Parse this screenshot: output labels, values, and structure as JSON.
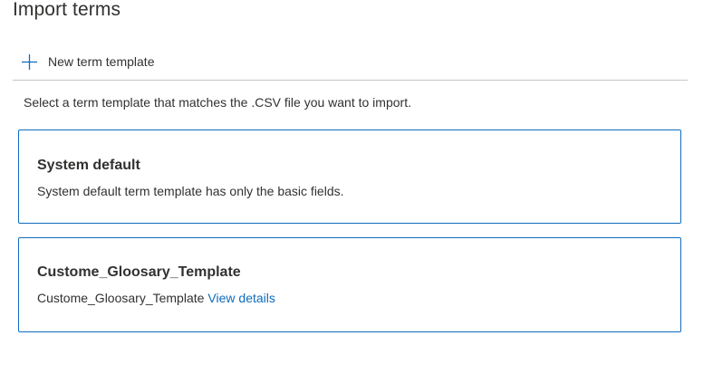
{
  "page": {
    "title": "Import terms"
  },
  "toolbar": {
    "new_template_label": "New term template",
    "new_template_icon": "plus-icon"
  },
  "instructions": "Select a term template that matches the .CSV file you want to import.",
  "templates": [
    {
      "title": "System default",
      "description": "System default term template has only the basic fields.",
      "link": ""
    },
    {
      "title": "Custome_Gloosary_Template",
      "description": "Custome_Gloosary_Template",
      "link": "View details"
    }
  ],
  "colors": {
    "accent": "#0f6cbd",
    "text": "#323130",
    "divider": "#c8c6c4"
  }
}
